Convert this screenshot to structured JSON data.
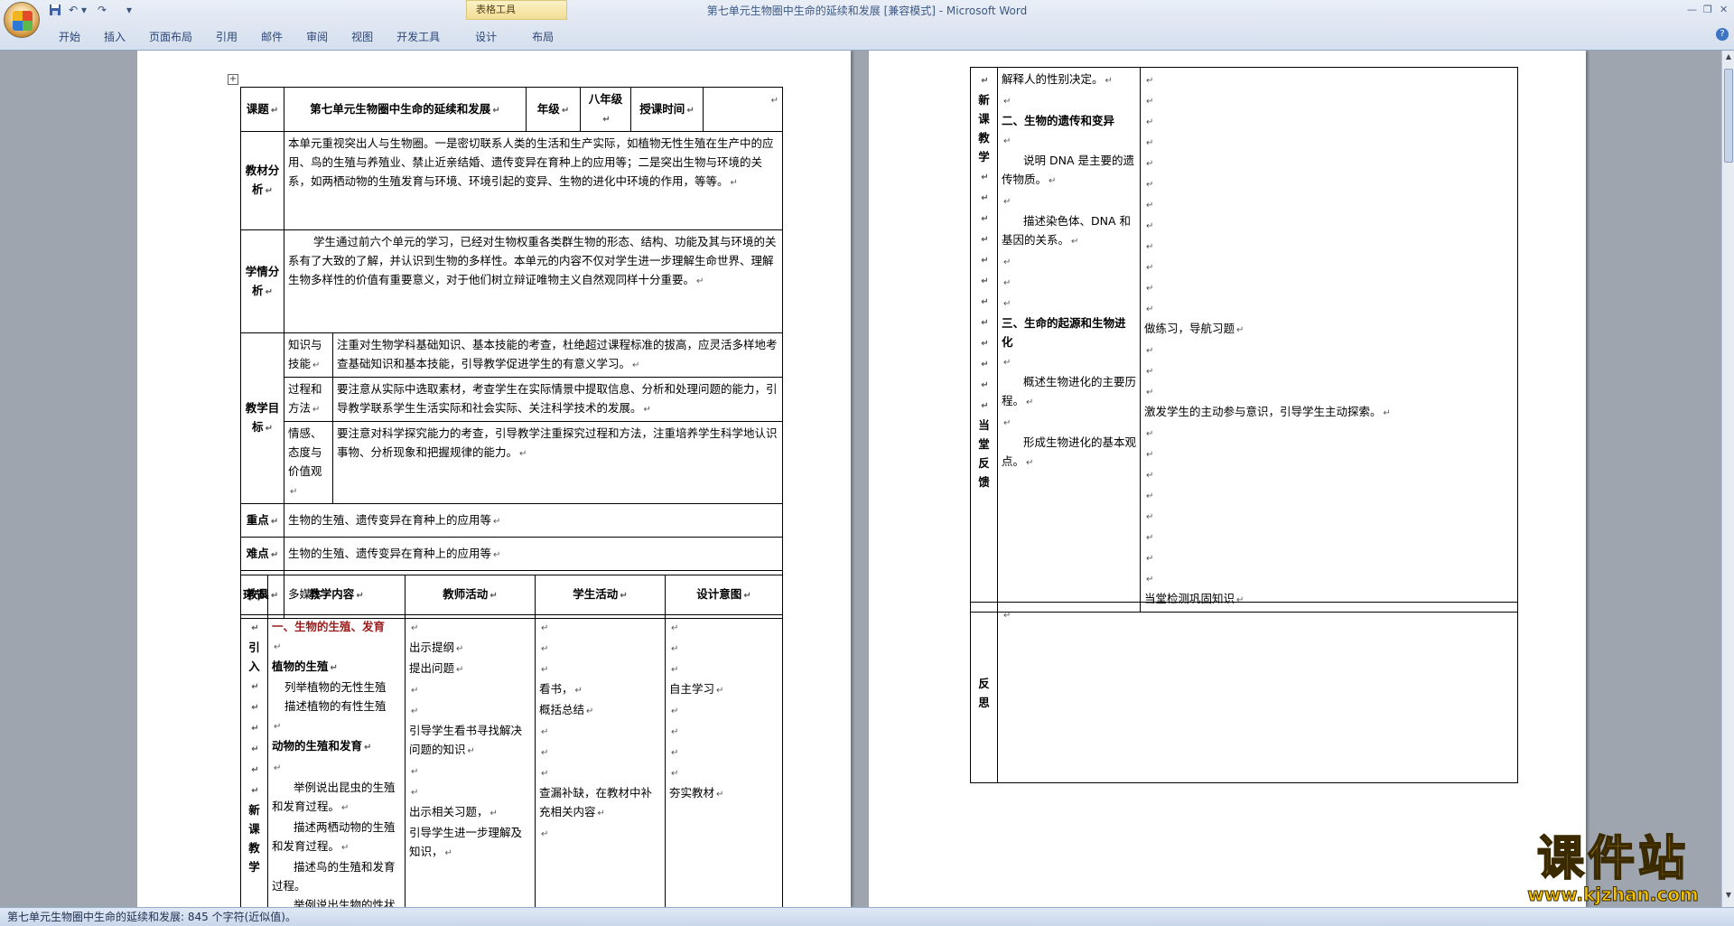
{
  "window": {
    "title": "第七单元生物圈中生命的延续和发展 [兼容模式] - Microsoft Word",
    "contextual_tab_group": "表格工具",
    "controls": {
      "minimize": "—",
      "restore": "❐",
      "close": "✕"
    }
  },
  "ribbon": {
    "tabs": [
      "开始",
      "插入",
      "页面布局",
      "引用",
      "邮件",
      "审阅",
      "视图",
      "开发工具",
      "设计",
      "布局"
    ],
    "help": "?"
  },
  "page1": {
    "lesson_label": "课题",
    "lesson_title": "第七单元生物圈中生命的延续和发展",
    "grade_label": "年级",
    "grade_value": "八年级",
    "time_label": "授课时间",
    "textbook_label": "教材分析",
    "textbook_text": "本单元重视突出人与生物圈。一是密切联系人类的生活和生产实际，如植物无性生殖在生产中的应用、鸟的生殖与养殖业、禁止近亲结婚、遗传变异在育种上的应用等；二是突出生物与环境的关系，如两栖动物的生殖发育与环境、环境引起的变异、生物的进化中环境的作用，等等。",
    "student_label": "学情分析",
    "student_text": "学生通过前六个单元的学习，已经对生物权重各类群生物的形态、结构、功能及其与环境的关系有了大致的了解，并认识到生物的多样性。本单元的内容不仅对学生进一步理解生命世界、理解生物多样性的价值有重要意义，对于他们树立辩证唯物主义自然观同样十分重要。",
    "goals_label": "教学目标",
    "goals": [
      {
        "label": "知识与技能",
        "text": "注重对生物学科基础知识、基本技能的考查，杜绝超过课程标准的拔高，应灵活多样地考查基础知识和基本技能，引导教学促进学生的有意义学习。"
      },
      {
        "label": "过程和方法",
        "text": "要注意从实际中选取素材，考查学生在实际情景中提取信息、分析和处理问题的能力，引导教学联系学生生活实际和社会实际、关注科学技术的发展。"
      },
      {
        "label": "情感、态度与价值观",
        "text": "要注意对科学探究能力的考查，引导教学注重探究过程和方法，注重培养学生科学地认识事物、分析现象和把握规律的能力。"
      }
    ],
    "key_label": "重点",
    "key_text": "生物的生殖、遗传变异在育种上的应用等",
    "difficulty_label": "难点",
    "difficulty_text": "生物的生殖、遗传变异在育种上的应用等",
    "tools_label": "教具",
    "tools_text": "多媒体",
    "process": {
      "headers": [
        "环节",
        "教学内容",
        "教师活动",
        "学生活动",
        "设计意图"
      ],
      "stage_intro": "引入",
      "stage_new": "新课教学",
      "content": {
        "section1": "一、生物的生殖、发育",
        "plant_title": "植物的生殖",
        "plant_1": "列举植物的无性生殖",
        "plant_2": "描述植物的有性生殖",
        "animal_title": "动物的生殖和发育",
        "animal_1": "举例说出昆虫的生殖和发育过程。",
        "animal_2": "描述两栖动物的生殖和发育过程。",
        "animal_3": "描述鸟的生殖和发育过程。",
        "animal_4": "举例说出生物的性状是由基因控制的"
      },
      "teacher": {
        "t1": "出示提纲",
        "t2": "提出问题",
        "t3": "引导学生看书寻找解决问题的知识",
        "t4": "出示相关习题，",
        "t5": "引导学生进一步理解及知识，"
      },
      "student": {
        "s1": "看书，",
        "s2": "概括总结",
        "s3": "查漏补缺，在教材中补充相关内容"
      },
      "design": {
        "d1": "自主学习",
        "d2": "夯实教材"
      }
    }
  },
  "page2": {
    "stage_new": "新课教学",
    "stage_feedback": "当堂反馈",
    "content": {
      "c1": "解释人的性别决定。",
      "section2": "二、生物的遗传和变异",
      "c2": "说明 DNA 是主要的遗传物质。",
      "c3": "描述染色体、DNA 和基因的关系。",
      "section3": "三、生命的起源和生物进化",
      "c4": "概述生物进化的主要历程。",
      "c5": "形成生物进化的基本观点。"
    },
    "right": {
      "r1": "做练习，导航习题",
      "r2": "激发学生的主动参与意识，引导学生主动探索。",
      "r3": "当堂检测巩固知识"
    },
    "reflection_label": "反思"
  },
  "statusbar": {
    "text": "第七单元生物圈中生命的延续和发展: 845 个字符(近似值)。"
  },
  "watermark": {
    "text": "课件站",
    "url": "www.kjzhan.com"
  },
  "marks": {
    "para": "↵"
  }
}
